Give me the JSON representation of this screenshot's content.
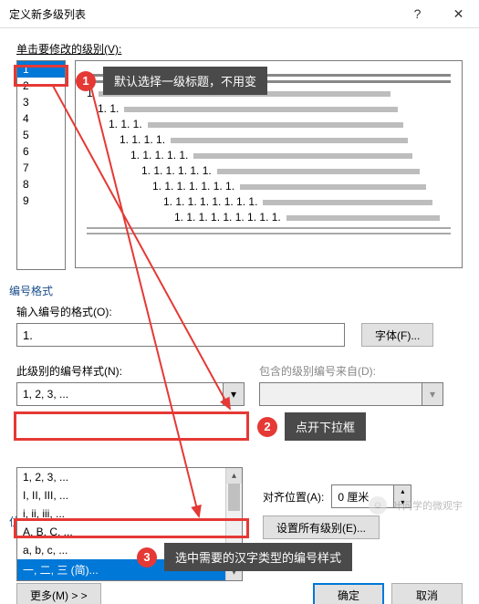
{
  "dialog": {
    "title": "定义新多级列表",
    "help_icon": "?",
    "close_icon": "✕"
  },
  "level_section": {
    "label": "单击要修改的级别(V):",
    "items": [
      "1",
      "2",
      "3",
      "4",
      "5",
      "6",
      "7",
      "8",
      "9"
    ],
    "selected": "1"
  },
  "preview_lines": [
    {
      "text": "1",
      "indent": 0,
      "bar": 320
    },
    {
      "text": "1. 1.",
      "indent": 12,
      "bar": 300
    },
    {
      "text": "1. 1. 1.",
      "indent": 24,
      "bar": 280
    },
    {
      "text": "1. 1. 1. 1.",
      "indent": 36,
      "bar": 260
    },
    {
      "text": "1. 1. 1. 1. 1.",
      "indent": 48,
      "bar": 240
    },
    {
      "text": "1. 1. 1. 1. 1. 1.",
      "indent": 60,
      "bar": 222
    },
    {
      "text": "1. 1. 1. 1. 1. 1. 1.",
      "indent": 72,
      "bar": 204
    },
    {
      "text": "1. 1. 1. 1. 1. 1. 1. 1.",
      "indent": 84,
      "bar": 186
    },
    {
      "text": "1. 1. 1. 1. 1. 1. 1. 1. 1.",
      "indent": 96,
      "bar": 168
    }
  ],
  "number_format": {
    "section_title": "编号格式",
    "format_label": "输入编号的格式(O):",
    "format_value": "1.",
    "font_button": "字体(F)...",
    "style_label": "此级别的编号样式(N):",
    "style_value": "1, 2, 3, ...",
    "include_label": "包含的级别编号来自(D):",
    "include_value": ""
  },
  "dropdown_options": [
    "1, 2, 3, ...",
    "I, II, III, ...",
    "i, ii, iii, ...",
    "A, B, C, ...",
    "a, b, c, ...",
    "一, 二, 三 (简)..."
  ],
  "position": {
    "section_title_partial": "位",
    "align_label": "对齐位置(A):",
    "align_value": "0 厘米",
    "set_all_button": "设置所有级别(E)..."
  },
  "footer": {
    "more_button": "更多(M) > >",
    "ok_button": "确定",
    "cancel_button": "取消"
  },
  "callouts": {
    "c1": {
      "n": "1",
      "text": "默认选择一级标题，不用变"
    },
    "c2": {
      "n": "2",
      "text": "点开下拉框"
    },
    "c3": {
      "n": "3",
      "text": "选中需要的汉字类型的编号样式"
    }
  },
  "chevron_down": "▾",
  "chevron_up": "▴",
  "watermark": "叶问学的微观宇"
}
